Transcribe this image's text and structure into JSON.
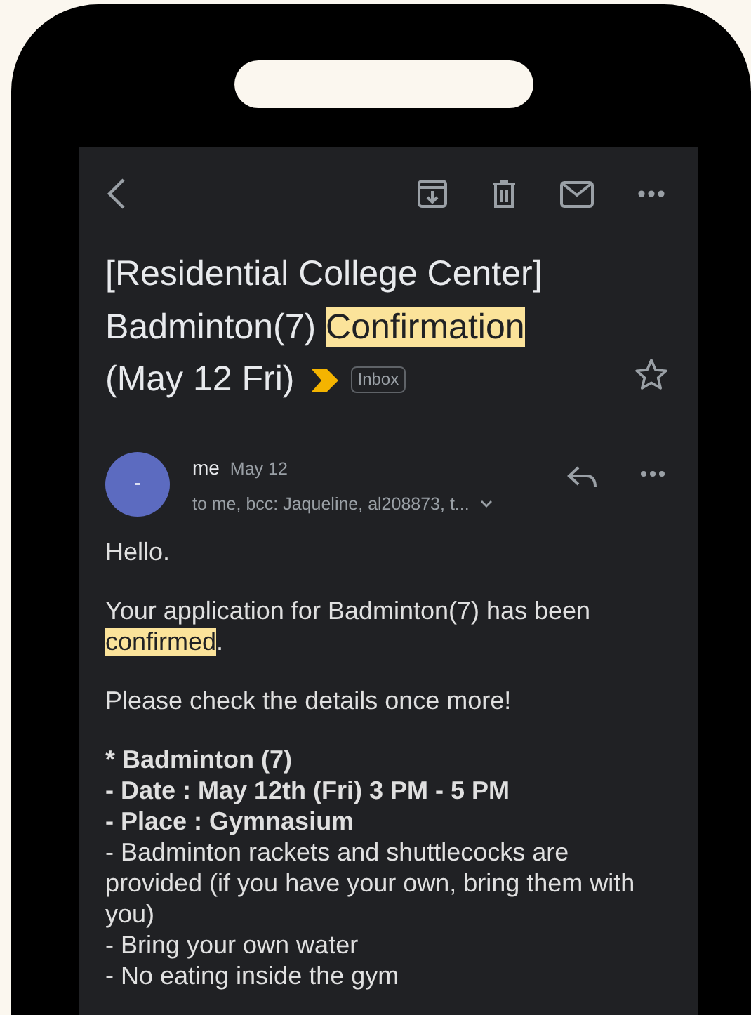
{
  "subject_lines": [
    [
      {
        "text": "[Residential College Center]",
        "highlighted": false
      }
    ],
    [
      {
        "text": "Badminton(7) ",
        "highlighted": false
      },
      {
        "text": "Confirmation",
        "highlighted": true
      }
    ],
    [
      {
        "text": "(May 12 Fri)",
        "highlighted": false
      }
    ]
  ],
  "starred": false,
  "label": "Inbox",
  "message": {
    "avatar": "-",
    "sender": "me",
    "date": "May 12",
    "recipients": "to me, bcc: Jaqueline, al208873, t..."
  },
  "body": [
    {
      "kind": "text",
      "segments": [
        {
          "text": "Hello.",
          "highlighted": false
        }
      ]
    },
    {
      "kind": "text",
      "segments": [
        {
          "text": "Your application for Badminton(7) has been ",
          "highlighted": false
        },
        {
          "text": "confirmed",
          "highlighted": true
        },
        {
          "text": ".",
          "highlighted": false
        }
      ]
    },
    {
      "kind": "text",
      "segments": [
        {
          "text": "Please check the details once more!",
          "highlighted": false
        }
      ]
    },
    {
      "kind": "details",
      "lines": [
        {
          "bold": true,
          "text": "* Badminton (7)"
        },
        {
          "bold": true,
          "text": "- Date : May 12th (Fri) 3 PM - 5 PM"
        },
        {
          "bold": true,
          "text": "- Place : Gymnasium"
        },
        {
          "bold": false,
          "text": "- Badminton rackets and shuttlecocks are provided (if you have your own, bring them with you)"
        },
        {
          "bold": false,
          "text": "- Bring your own water"
        },
        {
          "bold": false,
          "text": "- No eating inside the gym"
        }
      ]
    }
  ]
}
